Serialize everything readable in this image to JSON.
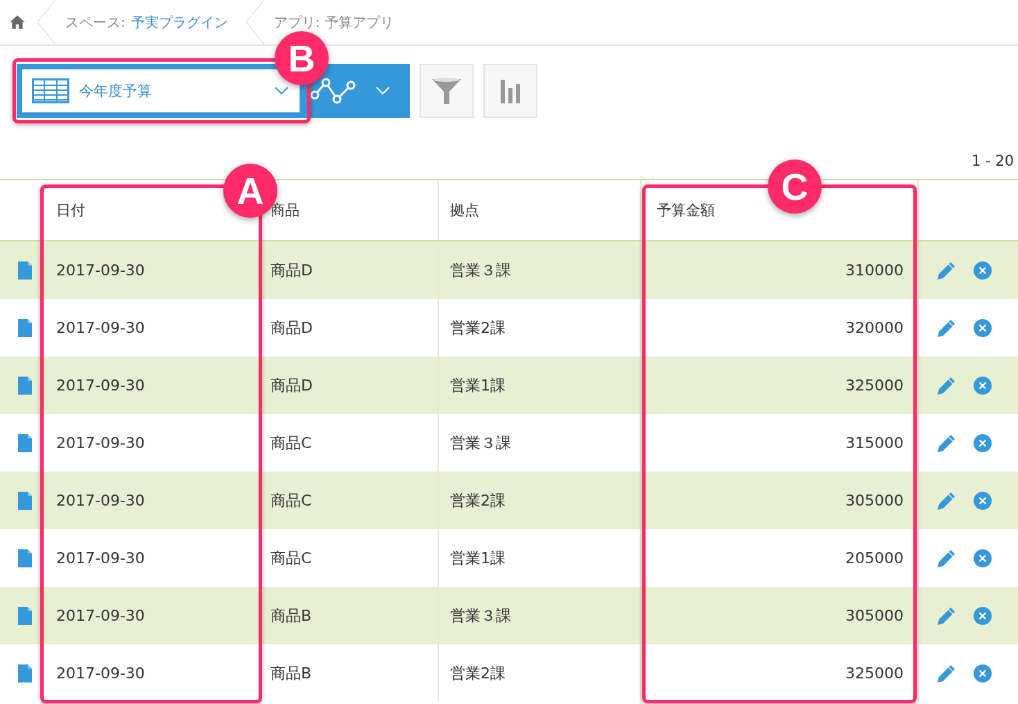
{
  "breadcrumb": {
    "space_label": "スペース:",
    "space_link": "予実プラグイン",
    "app": "アプリ: 予算アプリ"
  },
  "view_select": {
    "value": "今年度予算"
  },
  "pager": "1 - 20",
  "table": {
    "columns": [
      "日付",
      "商品",
      "拠点",
      "予算金額"
    ],
    "rows": [
      {
        "date": "2017-09-30",
        "product": "商品D",
        "location": "営業３課",
        "amount": "310000"
      },
      {
        "date": "2017-09-30",
        "product": "商品D",
        "location": "営業2課",
        "amount": "320000"
      },
      {
        "date": "2017-09-30",
        "product": "商品D",
        "location": "営業1課",
        "amount": "325000"
      },
      {
        "date": "2017-09-30",
        "product": "商品C",
        "location": "営業３課",
        "amount": "315000"
      },
      {
        "date": "2017-09-30",
        "product": "商品C",
        "location": "営業2課",
        "amount": "305000"
      },
      {
        "date": "2017-09-30",
        "product": "商品C",
        "location": "営業1課",
        "amount": "205000"
      },
      {
        "date": "2017-09-30",
        "product": "商品B",
        "location": "営業３課",
        "amount": "305000"
      },
      {
        "date": "2017-09-30",
        "product": "商品B",
        "location": "営業2課",
        "amount": "325000"
      }
    ]
  },
  "callouts": [
    {
      "label": "B"
    },
    {
      "label": "A"
    },
    {
      "label": "C"
    }
  ]
}
